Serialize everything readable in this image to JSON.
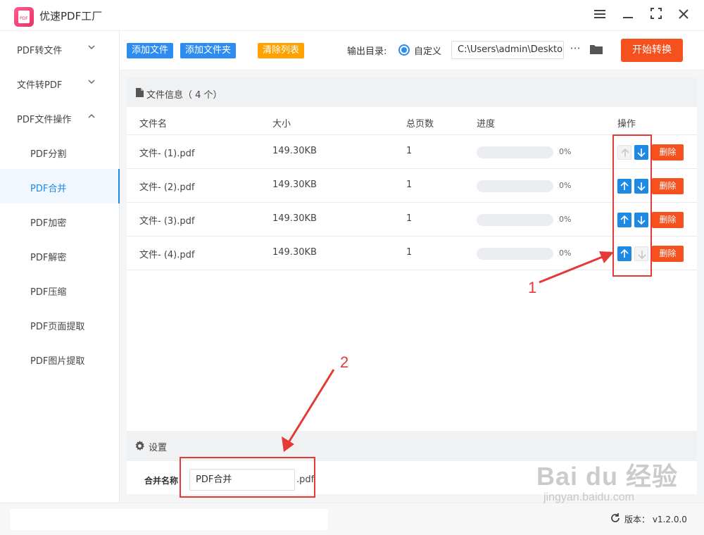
{
  "app": {
    "title": "优速PDF工厂"
  },
  "sidebar": {
    "items": [
      {
        "label": "PDF转文件"
      },
      {
        "label": "文件转PDF"
      },
      {
        "label": "PDF文件操作"
      },
      {
        "label": "PDF分割"
      },
      {
        "label": "PDF合并"
      },
      {
        "label": "PDF加密"
      },
      {
        "label": "PDF解密"
      },
      {
        "label": "PDF压缩"
      },
      {
        "label": "PDF页面提取"
      },
      {
        "label": "PDF图片提取"
      }
    ]
  },
  "toolbar": {
    "add_file": "添加文件",
    "add_folder": "添加文件夹",
    "clear_list": "清除列表",
    "output_label": "输出目录:",
    "custom_label": "自定义",
    "output_path": "C:\\Users\\admin\\Deskto",
    "start": "开始转换"
  },
  "files": {
    "title": "文件信息（ 4 个）",
    "columns": [
      "文件名",
      "大小",
      "总页数",
      "进度",
      "操作"
    ],
    "rows": [
      {
        "name": "文件- (1).pdf",
        "size": "149.30KB",
        "pages": "1",
        "progress": "0%",
        "up_enabled": false,
        "down_enabled": true,
        "delete": "删除"
      },
      {
        "name": "文件- (2).pdf",
        "size": "149.30KB",
        "pages": "1",
        "progress": "0%",
        "up_enabled": true,
        "down_enabled": true,
        "delete": "删除"
      },
      {
        "name": "文件- (3).pdf",
        "size": "149.30KB",
        "pages": "1",
        "progress": "0%",
        "up_enabled": true,
        "down_enabled": true,
        "delete": "删除"
      },
      {
        "name": "文件- (4).pdf",
        "size": "149.30KB",
        "pages": "1",
        "progress": "0%",
        "up_enabled": true,
        "down_enabled": false,
        "delete": "删除"
      }
    ]
  },
  "settings": {
    "title": "设置",
    "merge_name_label": "合并名称",
    "merge_name_value": "PDF合并",
    "merge_ext": ".pdf"
  },
  "status": {
    "version": "版本：  v1.2.0.0"
  },
  "annotations": {
    "label_1": "1",
    "label_2": "2"
  },
  "watermark": {
    "logo": "Bai du 经验",
    "url": "jingyan.baidu.com"
  },
  "colors": {
    "accent": "#2d8cf0",
    "danger": "#f4511e",
    "warning": "#ffa200",
    "annotation": "#e53935"
  }
}
